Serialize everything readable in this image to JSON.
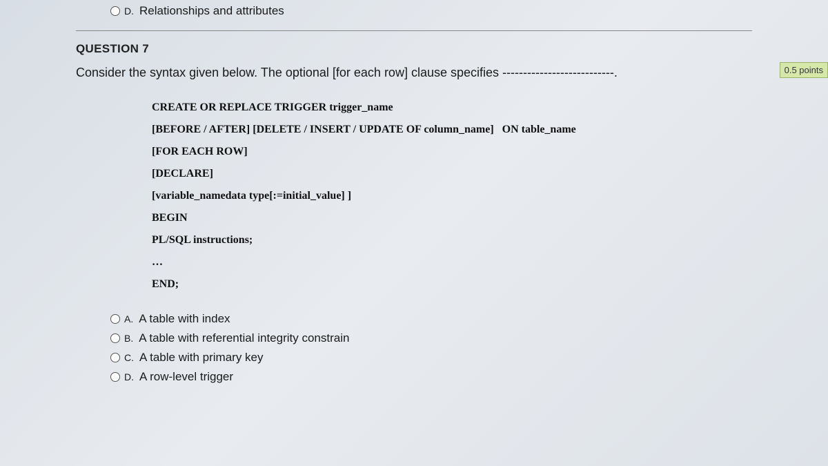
{
  "prev_question": {
    "option_d": {
      "letter": "D.",
      "text": "Relationships and attributes"
    }
  },
  "question": {
    "number_label": "QUESTION 7",
    "points": "0.5 points",
    "prompt": "Consider the syntax given below. The optional [for each row] clause specifies ---------------------------.",
    "code": {
      "l1": "CREATE OR REPLACE TRIGGER trigger_name",
      "l2": "[BEFORE / AFTER] [DELETE / INSERT / UPDATE OF column_name]   ON table_name",
      "l3": "[FOR EACH ROW]",
      "l4": "[DECLARE]",
      "l5": "[variable_namedata type[:=initial_value] ]",
      "l6": "BEGIN",
      "l7": "PL/SQL instructions;",
      "l8": "…",
      "l9": "END;"
    },
    "options": {
      "a": {
        "letter": "A.",
        "text": "A table with index"
      },
      "b": {
        "letter": "B.",
        "text": "A table with referential integrity constrain"
      },
      "c": {
        "letter": "C.",
        "text": "A table with primary key"
      },
      "d": {
        "letter": "D.",
        "text": "A row-level trigger"
      }
    }
  }
}
